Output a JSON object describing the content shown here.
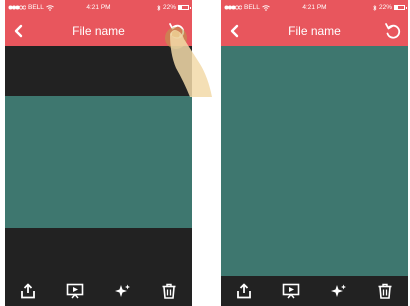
{
  "colors": {
    "accent": "#e8565d",
    "dark_bg": "#222222",
    "image_teal": "#3e776f"
  },
  "screens": [
    {
      "status": {
        "carrier": "BELL",
        "time": "4:21 PM",
        "battery": "22%"
      },
      "nav": {
        "title": "File name",
        "back_icon": "chevron-left-icon",
        "rotate_icon": "rotate-ccw-icon"
      },
      "toolbar": [
        "share-icon",
        "slideshow-icon",
        "sparkle-icon",
        "trash-icon"
      ]
    },
    {
      "status": {
        "carrier": "BELL",
        "time": "4:21 PM",
        "battery": "22%"
      },
      "nav": {
        "title": "File name",
        "back_icon": "chevron-left-icon",
        "rotate_icon": "rotate-ccw-icon"
      },
      "toolbar": [
        "share-icon",
        "slideshow-icon",
        "sparkle-icon",
        "trash-icon"
      ]
    }
  ]
}
